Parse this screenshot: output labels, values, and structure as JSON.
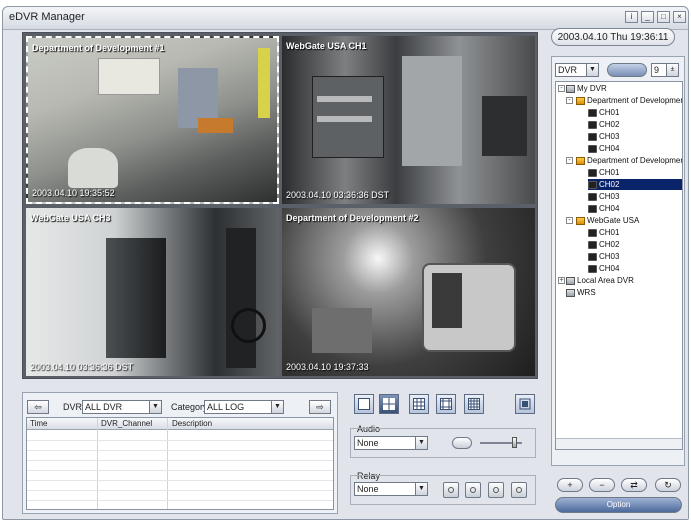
{
  "window": {
    "title": "eDVR Manager"
  },
  "header": {
    "datetime": "2003.04.10 Thu 19:36:11"
  },
  "cameras": [
    {
      "label": "Department of Development #1",
      "timestamp": "2003.04.10 19:35:52"
    },
    {
      "label": "WebGate USA CH1",
      "timestamp": "2003.04.10 03:36:36 DST"
    },
    {
      "label": "WebGate USA CH3",
      "timestamp": "2003.04.10 03:36:36 DST"
    },
    {
      "label": "Department of Development #2",
      "timestamp": "2003.04.10 19:37:33"
    }
  ],
  "log": {
    "dvr_label": "DVR",
    "dvr_value": "ALL DVR",
    "category_label": "Category",
    "category_value": "ALL LOG",
    "columns": [
      "Time",
      "DVR_Channel",
      "Description"
    ]
  },
  "audio": {
    "label": "Audio",
    "value": "None"
  },
  "relay": {
    "label": "Relay",
    "value": "None"
  },
  "side": {
    "dvr_select": "DVR",
    "split_value": "9",
    "tree": [
      {
        "text": "My DVR",
        "level": 0,
        "icon": "monitor-icon"
      },
      {
        "text": "Department of Development",
        "level": 1,
        "icon": "dvr-icon"
      },
      {
        "text": "CH01",
        "level": 2,
        "icon": "camera-icon"
      },
      {
        "text": "CH02",
        "level": 2,
        "icon": "camera-icon"
      },
      {
        "text": "CH03",
        "level": 2,
        "icon": "camera-icon"
      },
      {
        "text": "CH04",
        "level": 2,
        "icon": "camera-icon"
      },
      {
        "text": "Department of Development",
        "level": 1,
        "icon": "dvr-icon"
      },
      {
        "text": "CH01",
        "level": 2,
        "icon": "camera-icon"
      },
      {
        "text": "CH02",
        "level": 2,
        "icon": "camera-icon",
        "selected": true
      },
      {
        "text": "CH03",
        "level": 2,
        "icon": "camera-icon"
      },
      {
        "text": "CH04",
        "level": 2,
        "icon": "camera-icon"
      },
      {
        "text": "WebGate USA",
        "level": 1,
        "icon": "dvr-icon"
      },
      {
        "text": "CH01",
        "level": 2,
        "icon": "camera-icon"
      },
      {
        "text": "CH02",
        "level": 2,
        "icon": "camera-icon"
      },
      {
        "text": "CH03",
        "level": 2,
        "icon": "camera-icon"
      },
      {
        "text": "CH04",
        "level": 2,
        "icon": "camera-icon"
      },
      {
        "text": "Local Area DVR",
        "level": 0,
        "icon": "network-icon"
      },
      {
        "text": "WRS",
        "level": 0,
        "icon": "wrs-icon"
      }
    ]
  },
  "footer": {
    "option_label": "Option"
  }
}
